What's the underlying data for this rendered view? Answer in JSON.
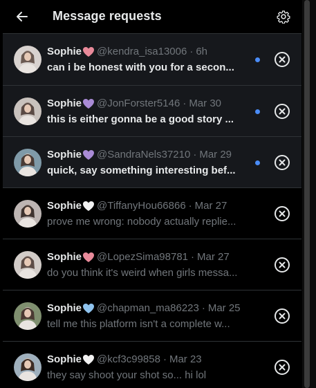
{
  "header": {
    "title": "Message requests",
    "back_icon": "arrow-left-icon",
    "settings_icon": "gear-icon"
  },
  "colors": {
    "background": "#000000",
    "unread_row": "#16181c",
    "divider": "#2f3336",
    "primary_text": "#e7e9ea",
    "secondary_text": "#71767b",
    "unread_dot": "#4a8cf7"
  },
  "requests": [
    {
      "name": "Sophie",
      "heart": "pink-heart",
      "heart_color": "#e88a9a",
      "handle": "@kendra_isa13006",
      "separator": "·",
      "time": "6h",
      "preview": "can i be honest with you for a secon...",
      "unread": true
    },
    {
      "name": "Sophie",
      "heart": "purple-heart",
      "heart_color": "#a98bd6",
      "handle": "@JonForster5146",
      "separator": "·",
      "time": "Mar 30",
      "preview": "this is either gonna be a good story ...",
      "unread": true
    },
    {
      "name": "Sophie",
      "heart": "purple-heart",
      "heart_color": "#a98bd6",
      "handle": "@SandraNels37210",
      "separator": "·",
      "time": "Mar 29",
      "preview": "quick, say something interesting bef...",
      "unread": true
    },
    {
      "name": "Sophie",
      "heart": "white-heart",
      "heart_color": "#f2f2f2",
      "handle": "@TiffanyHou66866",
      "separator": "·",
      "time": "Mar 27",
      "preview": "prove me wrong: nobody actually replie...",
      "unread": false
    },
    {
      "name": "Sophie",
      "heart": "pink-heart",
      "heart_color": "#e88a9a",
      "handle": "@LopezSima98781",
      "separator": "·",
      "time": "Mar 27",
      "preview": "do you think it's weird when girls messa...",
      "unread": false
    },
    {
      "name": "Sophie",
      "heart": "blue-heart",
      "heart_color": "#8fc3ee",
      "handle": "@chapman_ma86223",
      "separator": "·",
      "time": "Mar 25",
      "preview": "tell me this platform isn't a complete w...",
      "unread": false
    },
    {
      "name": "Sophie",
      "heart": "white-heart",
      "heart_color": "#f2f2f2",
      "handle": "@kcf3c99858",
      "separator": "·",
      "time": "Mar 23",
      "preview": "they say shoot your shot so... hi lol",
      "unread": false
    }
  ]
}
